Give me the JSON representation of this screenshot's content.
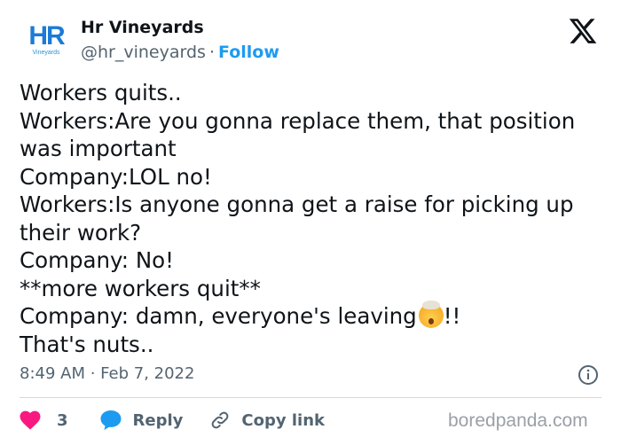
{
  "colors": {
    "brand_blue": "#1d9bf0",
    "text": "#0f1419",
    "muted": "#536471",
    "heart": "#f91880",
    "divider": "#cfd9de"
  },
  "author": {
    "avatar_logo_text": "HR",
    "avatar_logo_sub": "Vineyards",
    "name": "Hr Vineyards",
    "handle": "@hr_vineyards",
    "separator": "·",
    "follow_label": "Follow"
  },
  "platform_icon": "x-logo-icon",
  "tweet": {
    "lines": [
      "Workers quits..",
      "Workers:Are you gonna replace them, that position",
      "was important",
      "Company:LOL no!",
      "Workers:Is anyone gonna get a raise for picking up",
      "their work?",
      "Company: No!",
      "**more workers quit**",
      "Company: damn, everyone's leaving",
      "That's nuts.."
    ],
    "line9_suffix": "!!",
    "emoji": "exploding-head-emoji"
  },
  "meta": {
    "timestamp": "8:49 AM · Feb 7, 2022"
  },
  "actions": {
    "like_count": "3",
    "reply_label": "Reply",
    "copy_link_label": "Copy link"
  },
  "watermark": "boredpanda.com"
}
